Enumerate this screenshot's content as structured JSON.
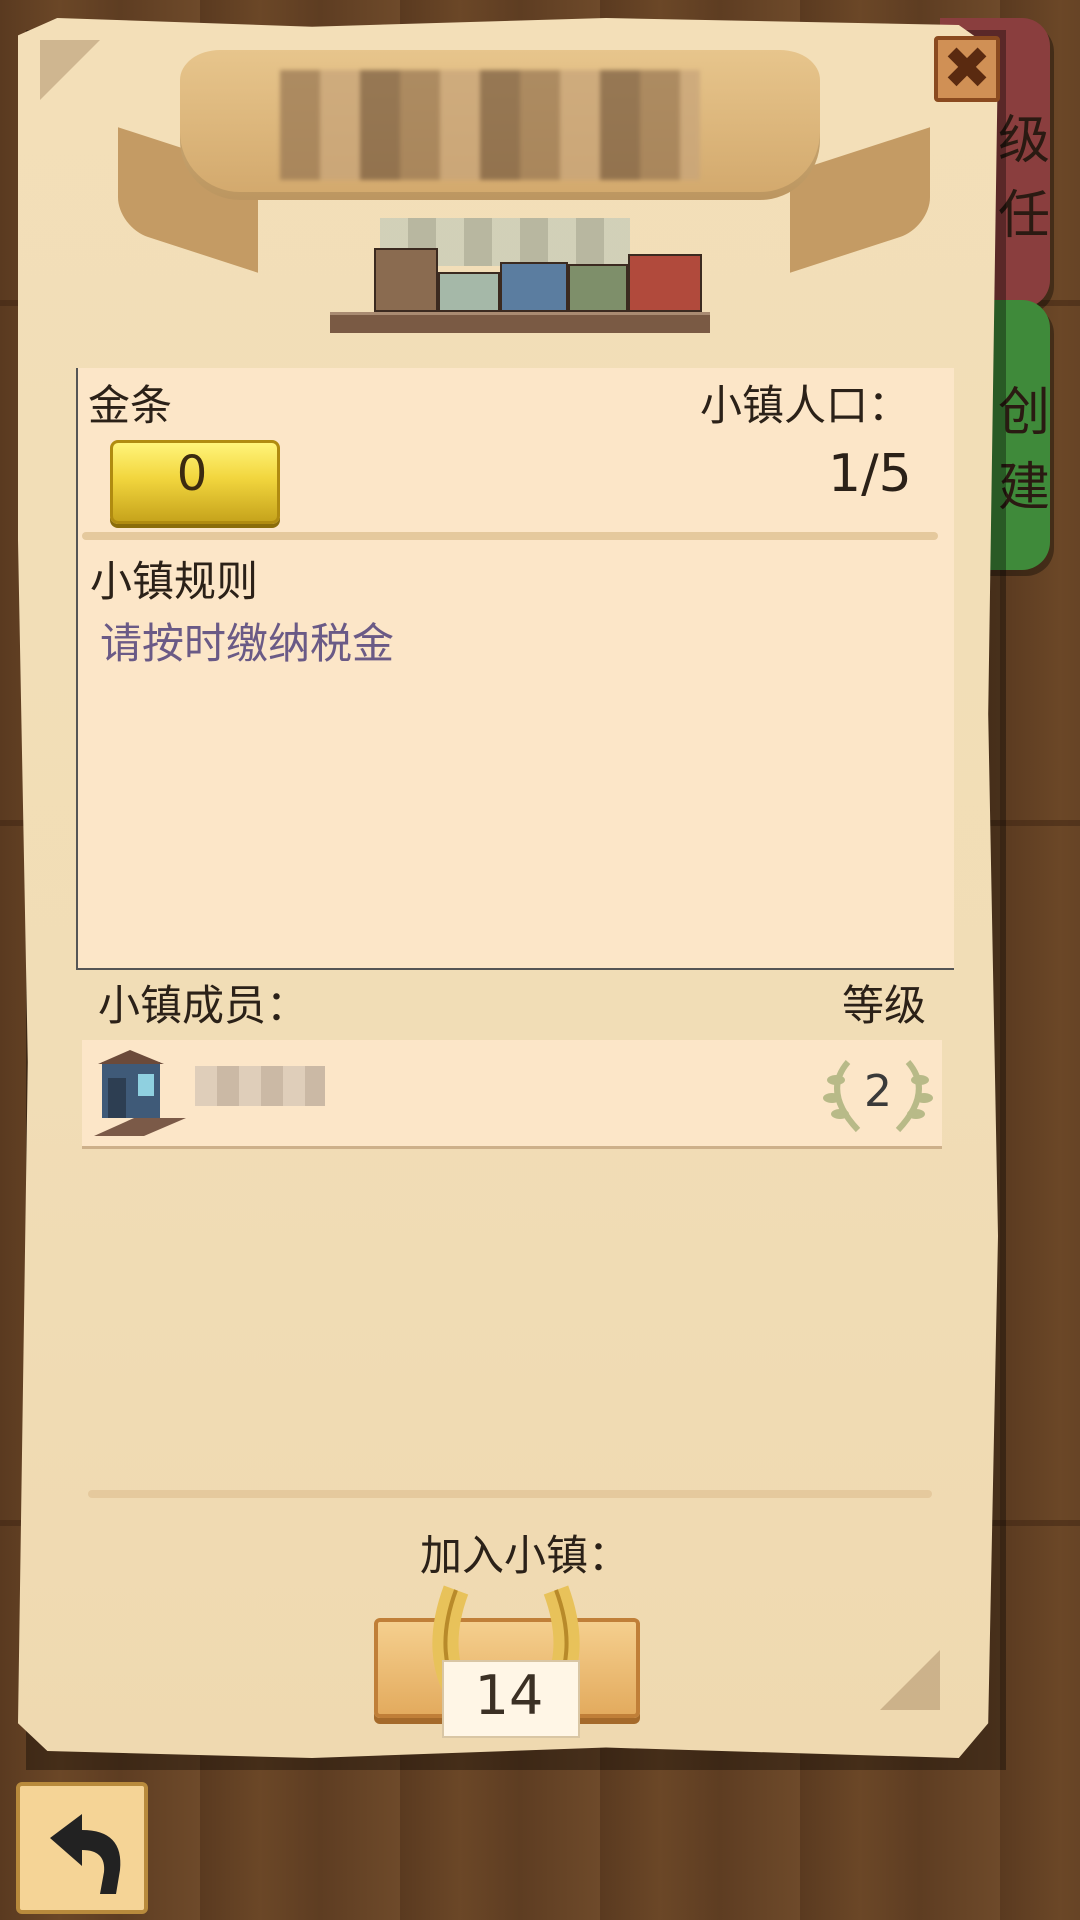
{
  "header": {
    "close_icon": "close-icon"
  },
  "side_tabs": [
    {
      "label": "级\n任",
      "color": "#8a3e3e"
    },
    {
      "label": "创\n建",
      "color": "#3f8a3a"
    }
  ],
  "info": {
    "gold_label": "金条",
    "gold_value": "0",
    "population_label": "小镇人口：",
    "population_value": "1/5",
    "rules_label": "小镇规则",
    "rules_text": "请按时缴纳税金"
  },
  "members": {
    "label": "小镇成员：",
    "level_header": "等级",
    "rows": [
      {
        "level": "2"
      }
    ]
  },
  "join": {
    "label": "加入小镇：",
    "price": "14",
    "price_icon": "horseshoe-icon"
  },
  "footer": {
    "back_icon": "back-arrow-icon"
  },
  "colors": {
    "parchment": "#f3dfb8",
    "panel": "#fce6c8",
    "rules_text": "#6a5a86",
    "gold": "#f2d63e"
  }
}
